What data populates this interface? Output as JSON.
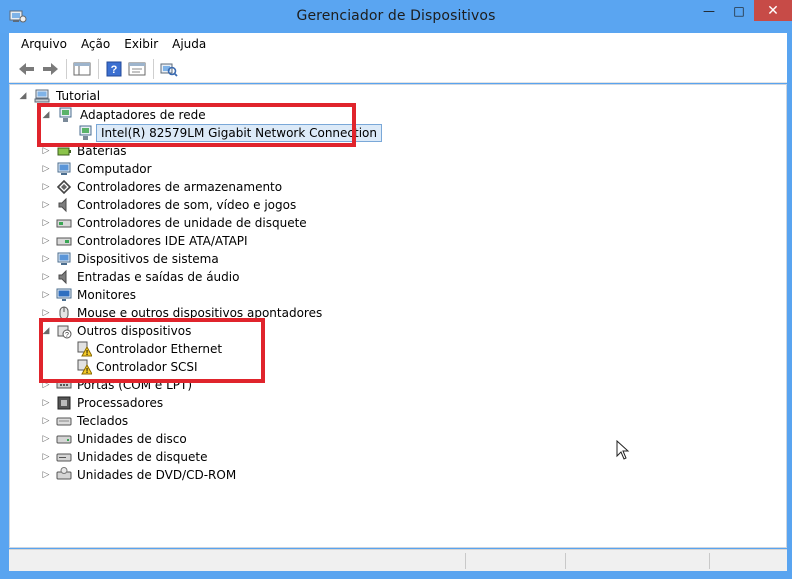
{
  "window": {
    "title": "Gerenciador de Dispositivos",
    "controls": {
      "minimize": "—",
      "maximize": "□",
      "close": "✕"
    }
  },
  "menu": [
    "Arquivo",
    "Ação",
    "Exibir",
    "Ajuda"
  ],
  "toolbar": {
    "buttons": [
      "back-arrow-icon",
      "forward-arrow-icon",
      "show-hide-tree-icon",
      "help-icon",
      "properties-icon",
      "scan-hardware-icon"
    ]
  },
  "tree": {
    "root": "Tutorial",
    "items": [
      {
        "label": "Adaptadores de rede",
        "expanded": true,
        "icon": "network-adapter-icon"
      },
      {
        "label": "Intel(R) 82579LM Gigabit Network Connection",
        "child": true,
        "selected": true,
        "icon": "network-card-icon"
      },
      {
        "label": "Baterias",
        "icon": "battery-icon"
      },
      {
        "label": "Computador",
        "icon": "computer-icon"
      },
      {
        "label": "Controladores de armazenamento",
        "icon": "storage-controller-icon"
      },
      {
        "label": "Controladores de som, vídeo e jogos",
        "icon": "speaker-icon"
      },
      {
        "label": "Controladores de unidade de disquete",
        "icon": "floppy-controller-icon"
      },
      {
        "label": "Controladores IDE ATA/ATAPI",
        "icon": "ide-controller-icon"
      },
      {
        "label": "Dispositivos de sistema",
        "icon": "system-device-icon"
      },
      {
        "label": "Entradas e saídas de áudio",
        "icon": "audio-io-icon"
      },
      {
        "label": "Monitores",
        "icon": "monitor-icon"
      },
      {
        "label": "Mouse e outros dispositivos apontadores",
        "icon": "mouse-icon"
      },
      {
        "label": "Outros dispositivos",
        "expanded": true,
        "icon": "unknown-device-icon"
      },
      {
        "label": "Controlador Ethernet",
        "child": true,
        "icon": "warning-device-icon"
      },
      {
        "label": "Controlador SCSI",
        "child": true,
        "icon": "warning-device-icon"
      },
      {
        "label": "Portas (COM e LPT)",
        "icon": "port-icon"
      },
      {
        "label": "Processadores",
        "icon": "processor-icon"
      },
      {
        "label": "Teclados",
        "icon": "keyboard-icon"
      },
      {
        "label": "Unidades de disco",
        "icon": "disk-drive-icon"
      },
      {
        "label": "Unidades de disquete",
        "icon": "floppy-drive-icon"
      },
      {
        "label": "Unidades de DVD/CD-ROM",
        "icon": "dvd-drive-icon"
      }
    ]
  },
  "colors": {
    "titlebar": "#5aa5f1",
    "close_button": "#c74b47",
    "highlight_box": "#e0242c",
    "selection": "#dceaf8"
  }
}
